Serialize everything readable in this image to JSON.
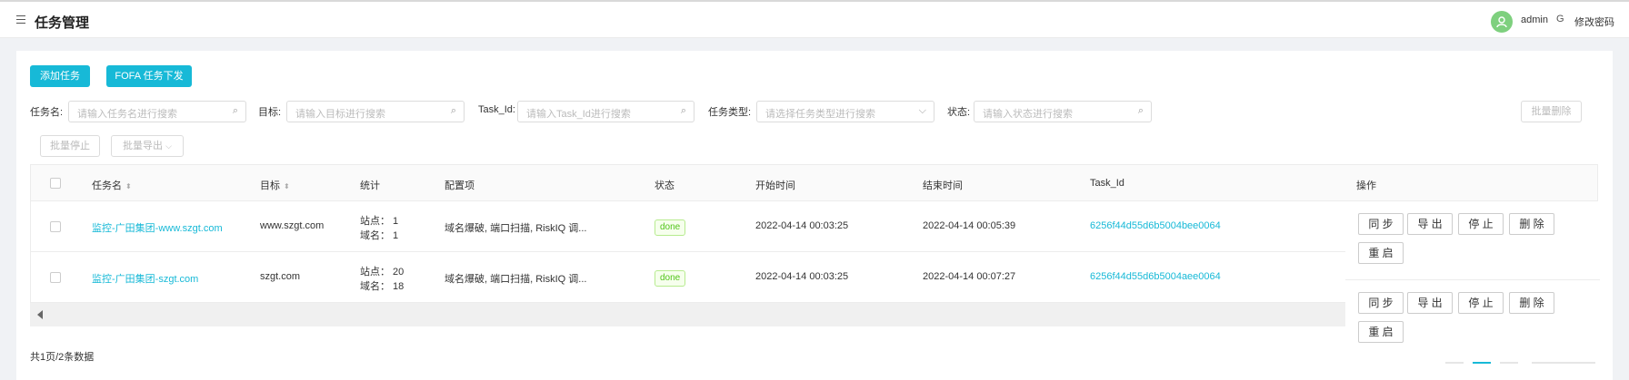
{
  "header": {
    "title": "任务管理",
    "user": "admin",
    "change_password": "修改密码"
  },
  "toolbar": {
    "add_task": "添加任务",
    "fofa_task": "FOFA 任务下发",
    "batch_delete": "批量删除",
    "batch_stop": "批量停止",
    "batch_export": "批量导出"
  },
  "filters": {
    "name_label": "任务名:",
    "name_placeholder": "请输入任务名进行搜索",
    "target_label": "目标:",
    "target_placeholder": "请输入目标进行搜索",
    "taskid_label": "Task_Id:",
    "taskid_placeholder": "请输入Task_Id进行搜索",
    "type_label": "任务类型:",
    "type_placeholder": "请选择任务类型进行搜索",
    "status_label": "状态:",
    "status_placeholder": "请输入状态进行搜索"
  },
  "table": {
    "columns": {
      "name": "任务名",
      "target": "目标",
      "stats": "统计",
      "config": "配置项",
      "status": "状态",
      "start": "开始时间",
      "end": "结束时间",
      "task_id": "Task_Id",
      "ops": "操作"
    },
    "rows": [
      {
        "name": "监控-广田集团-www.szgt.com",
        "target": "www.szgt.com",
        "stat_site": "站点：  1",
        "stat_domain": "域名：  1",
        "config": "域名爆破, 端口扫描, RiskIQ 调...",
        "status": "done",
        "start": "2022-04-14 00:03:25",
        "end": "2022-04-14 00:05:39",
        "task_id": "6256f44d55d6b5004bee0064"
      },
      {
        "name": "监控-广田集团-szgt.com",
        "target": "szgt.com",
        "stat_site": "站点：  20",
        "stat_domain": "域名：  18",
        "config": "域名爆破, 端口扫描, RiskIQ 调...",
        "status": "done",
        "start": "2022-04-14 00:03:25",
        "end": "2022-04-14 00:07:27",
        "task_id": "6256f44d55d6b5004aee0064"
      }
    ],
    "ops": {
      "sync": "同 步",
      "export": "导 出",
      "stop": "停 止",
      "delete": "删 除",
      "restart": "重 启"
    }
  },
  "footer": {
    "total": "共1页/2条数据"
  },
  "colors": {
    "primary": "#17b9d7",
    "done_green": "#52c41a",
    "avatar": "#7ed07e"
  }
}
